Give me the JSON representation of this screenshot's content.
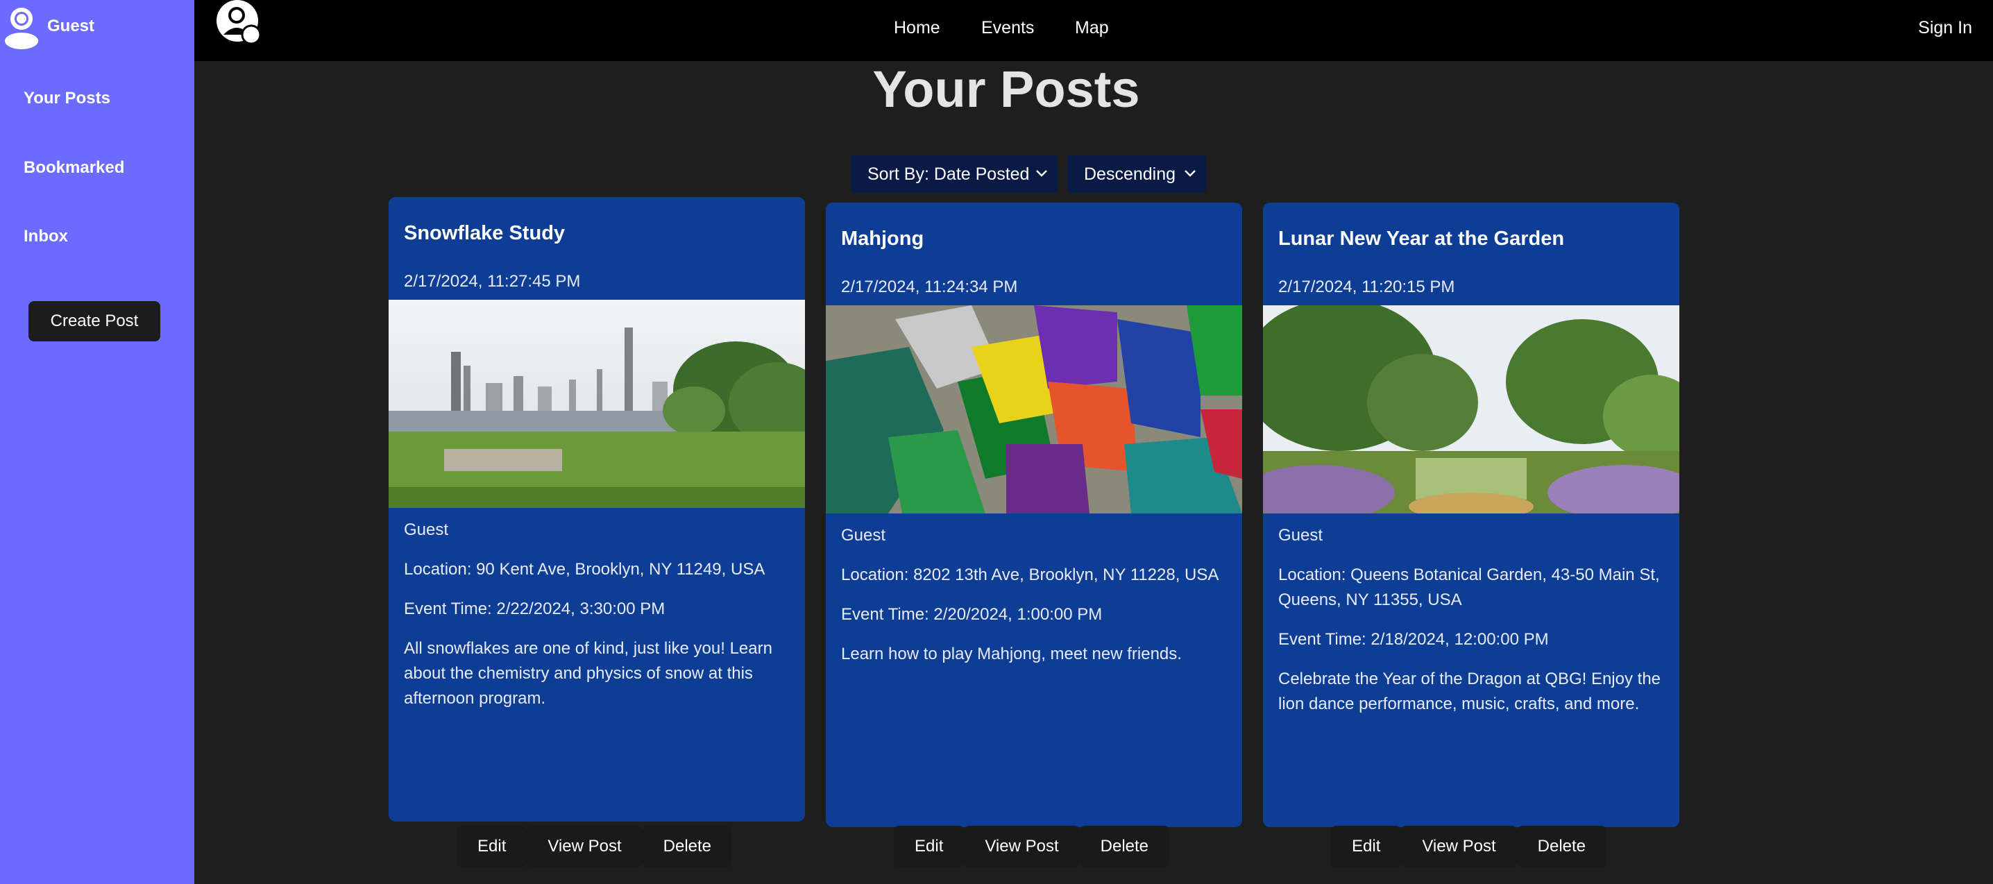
{
  "sidebar": {
    "user_name": "Guest",
    "items": [
      {
        "label": "Your Posts"
      },
      {
        "label": "Bookmarked"
      },
      {
        "label": "Inbox"
      }
    ],
    "create_button": "Create Post"
  },
  "topbar": {
    "nav": [
      {
        "label": "Home"
      },
      {
        "label": "Events"
      },
      {
        "label": "Map"
      }
    ],
    "sign_in": "Sign In"
  },
  "page": {
    "title": "Your Posts"
  },
  "sort": {
    "by": "Sort By: Date Posted",
    "order": "Descending"
  },
  "posts": [
    {
      "title": "Snowflake Study",
      "date": "2/17/2024, 11:27:45 PM",
      "author": "Guest",
      "location": "Location: 90 Kent Ave, Brooklyn, NY 11249, USA",
      "event_time": "Event Time: 2/22/2024, 3:30:00 PM",
      "description": "All snowflakes are one of kind, just like you! Learn about the chemistry and physics of snow at this afternoon program."
    },
    {
      "title": "Mahjong",
      "date": "2/17/2024, 11:24:34 PM",
      "author": "Guest",
      "location": "Location: 8202 13th Ave, Brooklyn, NY 11228, USA",
      "event_time": "Event Time: 2/20/2024, 1:00:00 PM",
      "description": "Learn how to play Mahjong, meet new friends."
    },
    {
      "title": "Lunar New Year at the Garden",
      "date": "2/17/2024, 11:20:15 PM",
      "author": "Guest",
      "location": "Location: Queens Botanical Garden, 43-50 Main St, Queens, NY 11355, USA",
      "event_time": "Event Time: 2/18/2024, 12:00:00 PM",
      "description": "Celebrate the Year of the Dragon at QBG! Enjoy the lion dance performance, music, crafts, and more."
    }
  ],
  "actions": {
    "edit": "Edit",
    "view": "View Post",
    "delete": "Delete"
  },
  "colors": {
    "sidebar_bg": "#6b6bff",
    "topbar_bg": "#000000",
    "page_bg": "#1e1e1e",
    "card_bg": "#0d3d94",
    "select_bg": "#0a1a47",
    "button_bg": "#1a1a1a"
  }
}
